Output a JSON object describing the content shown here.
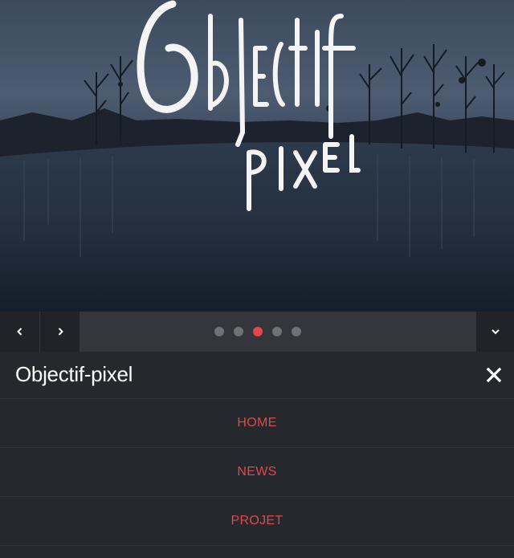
{
  "hero": {
    "logo_text_line1": "Objectif",
    "logo_text_line2": "pixel"
  },
  "slider": {
    "prev_icon": "chevron-left-icon",
    "next_icon": "chevron-right-icon",
    "expand_icon": "chevron-down-icon",
    "slide_count": 5,
    "active_slide": 3,
    "accent_color": "#e0484b"
  },
  "header": {
    "site_title": "Objectif-pixel",
    "close_icon": "close-icon"
  },
  "menu": {
    "items": [
      {
        "label": "HOME"
      },
      {
        "label": "NEWS"
      },
      {
        "label": "PROJET"
      }
    ]
  },
  "colors": {
    "background": "#25282d",
    "accent": "#e0484b",
    "text": "#ffffff"
  }
}
